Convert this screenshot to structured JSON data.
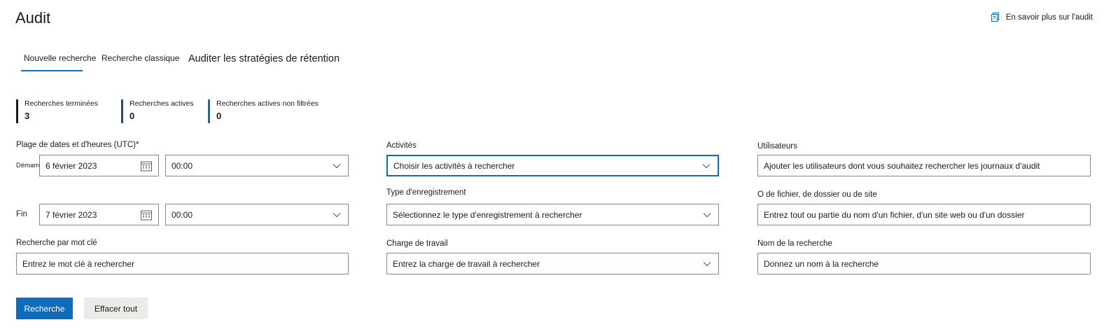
{
  "header": {
    "title": "Audit",
    "learn_more": "En savoir plus sur l'audit"
  },
  "tabs": [
    {
      "label": "Nouvelle recherche",
      "selected": true
    },
    {
      "label": "Recherche classique",
      "selected": false
    },
    {
      "label": "Auditer les stratégies de rétention",
      "selected": false
    }
  ],
  "stats": [
    {
      "label": "Recherches terminées",
      "value": "3",
      "color": "#1b1b1b"
    },
    {
      "label": "Recherches actives",
      "value": "0",
      "color": "#2b4a6e"
    },
    {
      "label": "Recherches actives non filtrées",
      "value": "0",
      "color": "#0f6cbd"
    }
  ],
  "form": {
    "date_range": {
      "label": "Plage de dates et d'heures (UTC)",
      "required_mark": "*",
      "start_label": "Démarrer",
      "start_date": "6 février 2023",
      "start_time": "00:00",
      "end_label": "Fin",
      "end_date": "7 février 2023",
      "end_time": "00:00"
    },
    "keyword": {
      "label": "Recherche par mot clé",
      "placeholder": "Entrez le mot clé à rechercher"
    },
    "activities": {
      "label": "Activités",
      "placeholder": "Choisir les activités à rechercher"
    },
    "record_type": {
      "label": "Type d'enregistrement",
      "placeholder": "Sélectionnez le type d'enregistrement à rechercher"
    },
    "workload": {
      "label": "Charge de travail",
      "placeholder": "Entrez la charge de travail à rechercher"
    },
    "users": {
      "label": "Utilisateurs",
      "placeholder": "Ajouter les utilisateurs dont vous souhaitez rechercher les journaux d'audit"
    },
    "file_folder_site": {
      "label": "O de fichier, de dossier ou de site",
      "placeholder": "Entrez tout ou partie du nom d'un fichier, d'un site web ou d'un dossier"
    },
    "search_name": {
      "label": "Nom de la recherche",
      "placeholder": "Donnez un nom à la recherche"
    }
  },
  "actions": {
    "search": "Recherche",
    "clear": "Effacer tout"
  },
  "colors": {
    "accent": "#0f6cbd",
    "border": "#8a8886",
    "secondary_button": "#edebe9"
  }
}
